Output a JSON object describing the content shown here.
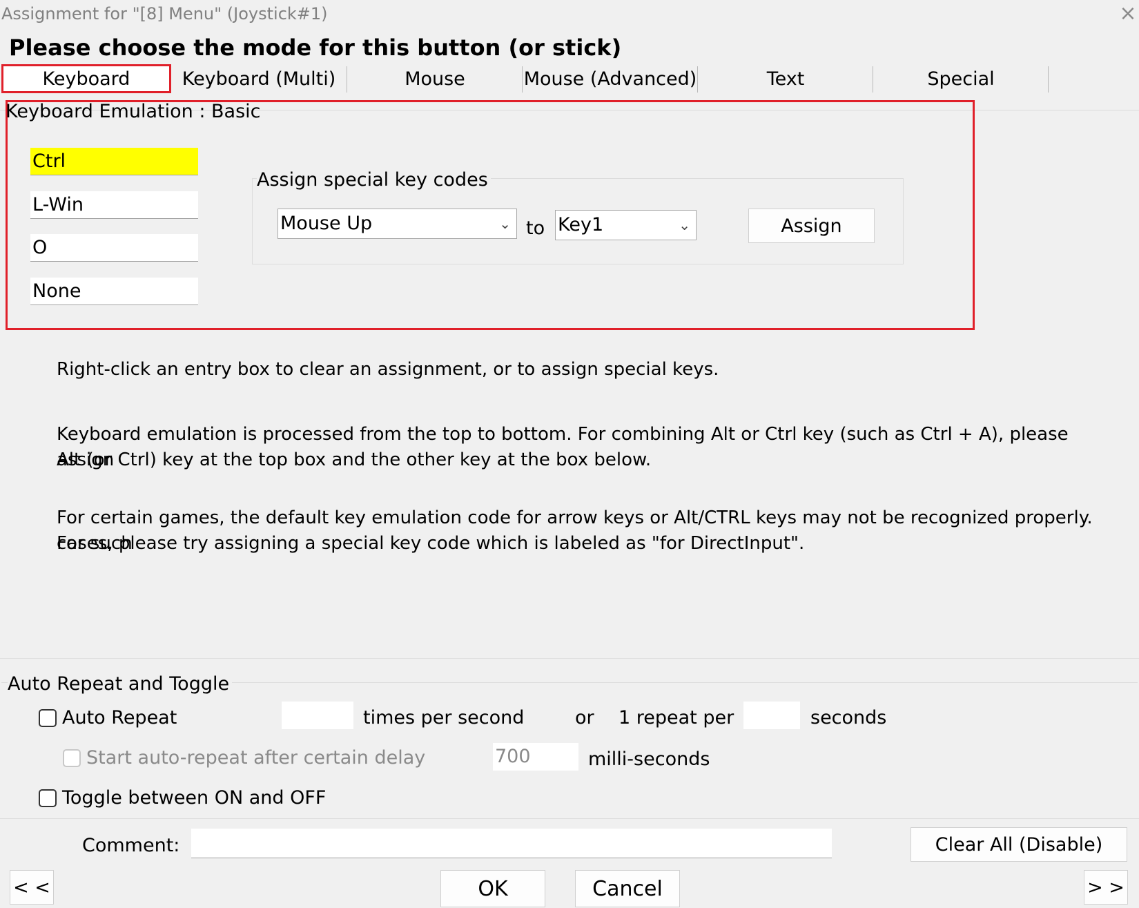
{
  "window": {
    "title": "Assignment for \"[8] Menu\" (Joystick#1)",
    "close_glyph": "×"
  },
  "heading": "Please choose the mode for this button (or stick)",
  "tabs": [
    {
      "label": "Keyboard",
      "active": true
    },
    {
      "label": "Keyboard (Multi)"
    },
    {
      "label": "Mouse"
    },
    {
      "label": "Mouse (Advanced)"
    },
    {
      "label": "Text"
    },
    {
      "label": "Special"
    }
  ],
  "keyboard_section": {
    "title": "Keyboard Emulation : Basic",
    "entries": [
      "Ctrl",
      "L-Win",
      "O",
      "None"
    ],
    "special_keys": {
      "group_label": "Assign special key codes",
      "from_value": "Mouse Up",
      "to_label": "to",
      "to_value": "Key1",
      "assign_label": "Assign"
    }
  },
  "help_text": {
    "p1": "Right-click an entry box to clear an assignment, or to assign special keys.",
    "p2_line1": "Keyboard emulation is processed from the top to bottom.  For combining Alt or Ctrl key (such as Ctrl + A), please assign",
    "p2_line2": "Alt (or Ctrl) key at the top box and the other key at the box below.",
    "p3_line1": "For certain games, the default key emulation code for arrow keys or Alt/CTRL keys may not be recognized properly.  For such",
    "p3_line2": "cases, please try assigning a special key code which is labeled as \"for DirectInput\"."
  },
  "auto_repeat": {
    "section_label": "Auto Repeat and Toggle",
    "auto_repeat_label": "Auto Repeat",
    "auto_repeat_checked": false,
    "times_per_second_value": "",
    "times_per_second_label": "times per second",
    "or_label": "or",
    "repeat_per_label": "1 repeat per",
    "seconds_value": "",
    "seconds_label": "seconds",
    "delay_label": "Start auto-repeat after certain delay",
    "delay_checked": false,
    "delay_value": "700",
    "delay_unit": "milli-seconds",
    "toggle_label": "Toggle between ON and OFF",
    "toggle_checked": false
  },
  "footer": {
    "comment_label": "Comment:",
    "comment_value": "",
    "clear_all_label": "Clear All (Disable)",
    "prev_label": "< <",
    "ok_label": "OK",
    "cancel_label": "Cancel",
    "next_label": "> >"
  },
  "colors": {
    "highlight_red": "#e0202a",
    "entry_highlight_yellow": "#ffff00"
  }
}
